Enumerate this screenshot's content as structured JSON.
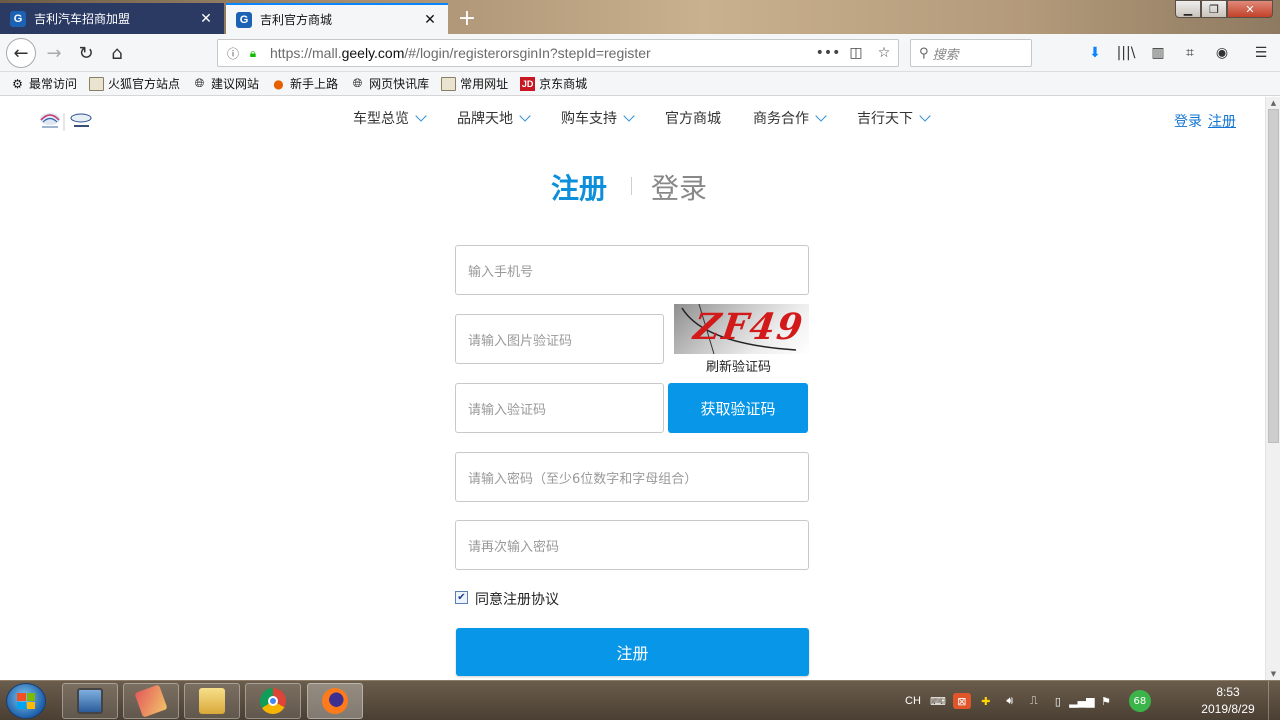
{
  "browser": {
    "tabs": [
      {
        "title": "吉利汽车招商加盟",
        "favicon": "G",
        "active": false
      },
      {
        "title": "吉利官方商城",
        "favicon": "G",
        "active": true
      }
    ],
    "url_prefix": "https://mall.",
    "url_domain": "geely.com",
    "url_suffix": "/#/login/registerorsginIn?stepId=register",
    "search_placeholder": "搜索",
    "bookmarks": [
      "最常访问",
      "火狐官方站点",
      "建议网站",
      "新手上路",
      "网页快讯库",
      "常用网址",
      "京东商城"
    ]
  },
  "site": {
    "nav": [
      "车型总览",
      "品牌天地",
      "购车支持",
      "官方商城",
      "商务合作",
      "吉行天下"
    ],
    "nav_has_dropdown": [
      true,
      true,
      true,
      false,
      true,
      true
    ],
    "top_login": "登录",
    "top_register": "注册"
  },
  "form": {
    "tab_register": "注册",
    "tab_login": "登录",
    "phone_placeholder": "输入手机号",
    "captcha_placeholder": "请输入图片验证码",
    "captcha_text": "ZF49",
    "refresh_captcha": "刷新验证码",
    "sms_placeholder": "请输入验证码",
    "get_code": "获取验证码",
    "password_placeholder": "请输入密码（至少6位数字和字母组合）",
    "password_confirm_placeholder": "请再次输入密码",
    "agree_checked": true,
    "agree_label": "同意注册协议",
    "submit": "注册"
  },
  "taskbar": {
    "lang": "CH",
    "badge": "68",
    "time": "8:53",
    "date": "2019/8/29"
  },
  "colors": {
    "accent": "#0896e8",
    "link": "#1476d2",
    "active_tab_heading": "#0d8fdc"
  }
}
